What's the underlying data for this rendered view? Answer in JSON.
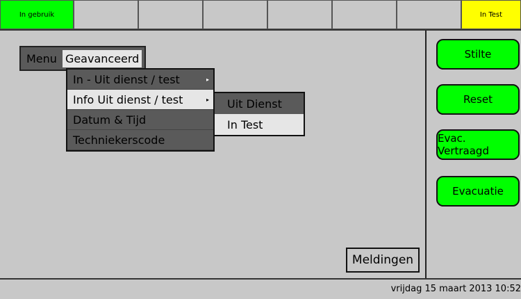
{
  "topbar": {
    "cells": [
      "In gebruik",
      "",
      "",
      "",
      "",
      "",
      "",
      "In Test"
    ]
  },
  "menubar": {
    "menu_label": "Menu",
    "active_item": "Geavanceerd"
  },
  "dropdown": {
    "items": [
      {
        "label": "In - Uit dienst / test",
        "has_submenu": true
      },
      {
        "label": "Info Uit dienst / test",
        "has_submenu": true
      },
      {
        "label": "Datum & Tijd",
        "has_submenu": false
      },
      {
        "label": "Techniekerscode",
        "has_submenu": false
      }
    ],
    "arrow": "▸"
  },
  "submenu": {
    "items": [
      "Uit Dienst",
      "In Test"
    ]
  },
  "right_buttons": [
    "Stilte",
    "Reset",
    "Evac. Vertraagd",
    "Evacuatie"
  ],
  "meldingen_label": "Meldingen",
  "status": {
    "datetime": "vrijdag 15 maart 2013 10:52"
  },
  "colors": {
    "green": "#00ff00",
    "yellow": "#ffff00",
    "background": "#c8c8c8",
    "menu_dark": "#5a5a5a",
    "menu_selected": "#e6e6e6"
  }
}
